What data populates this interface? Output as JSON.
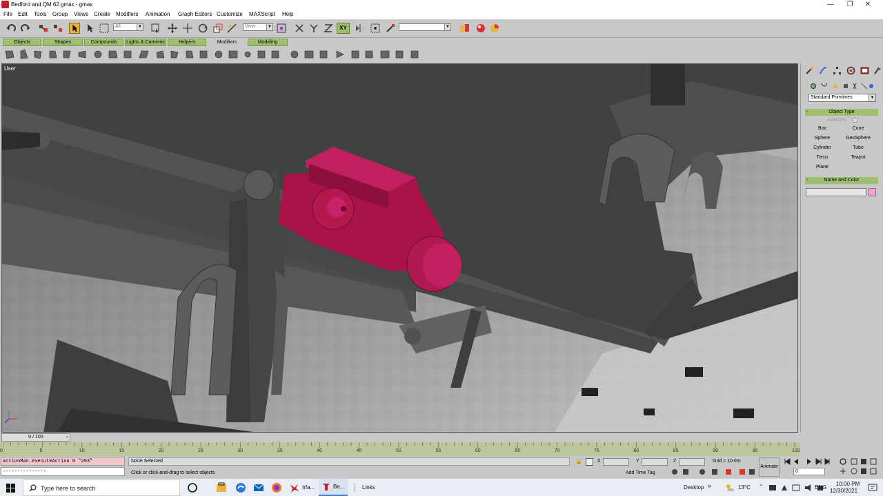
{
  "window": {
    "title": "Bedford and QM 62.gmax - gmax",
    "minimize": "—",
    "restore": "❐",
    "close": "✕"
  },
  "menu": [
    "File",
    "Edit",
    "Tools",
    "Group",
    "Views",
    "Create",
    "Modifiers",
    "Animation",
    "Graph Editors",
    "Customize",
    "MAXScript",
    "Help"
  ],
  "toolbar": {
    "selection_filter": "All",
    "ref_coord": "View",
    "axis_constraint": "XY",
    "named_selection": ""
  },
  "tabs": [
    "Objects",
    "Shapes",
    "Compounds",
    "Lights & Cameras",
    "Helpers",
    "Modifiers",
    "Modeling"
  ],
  "active_tab": "Modifiers",
  "viewport": {
    "label": "User",
    "selected_color": "#a8144a",
    "frame_color": "#4a4d4a"
  },
  "command_panel": {
    "category_dropdown": "Standard Primitives",
    "object_type_title": "Object Type",
    "autogrid_label": "AutoGrid",
    "primitives": [
      "Box",
      "Cone",
      "Sphere",
      "GeoSphere",
      "Cylinder",
      "Tube",
      "Torus",
      "Teapot",
      "Plane"
    ],
    "name_color_title": "Name and Color",
    "name_value": "",
    "swatch_color": "#f3a2d4"
  },
  "timeline": {
    "frame_display": "0 / 100",
    "ticks": [
      "0",
      "5",
      "10",
      "15",
      "20",
      "25",
      "30",
      "35",
      "40",
      "45",
      "50",
      "55",
      "60",
      "65",
      "70",
      "75",
      "80",
      "85",
      "90",
      "95",
      "100"
    ]
  },
  "status": {
    "maxscript_line1": "actionMan.executeAction 0 \"203\"",
    "maxscript_line2": "---------------",
    "selection": "None Selected",
    "prompt": "Click or click-and-drag to select objects",
    "x_label": "X",
    "y_label": "Y",
    "z_label": "Z",
    "grid": "Grid = 10.0m",
    "add_time_tag": "Add Time Tag",
    "auto_key": "Animate",
    "current_frame": "0"
  },
  "taskbar": {
    "search_placeholder": "Type here to search",
    "apps": [
      "Irfa...",
      "Be...",
      "Links"
    ],
    "desktop_label": "Desktop",
    "weather": "13°C",
    "language": "ENG",
    "time": "10:00 PM",
    "date": "12/30/2021"
  }
}
